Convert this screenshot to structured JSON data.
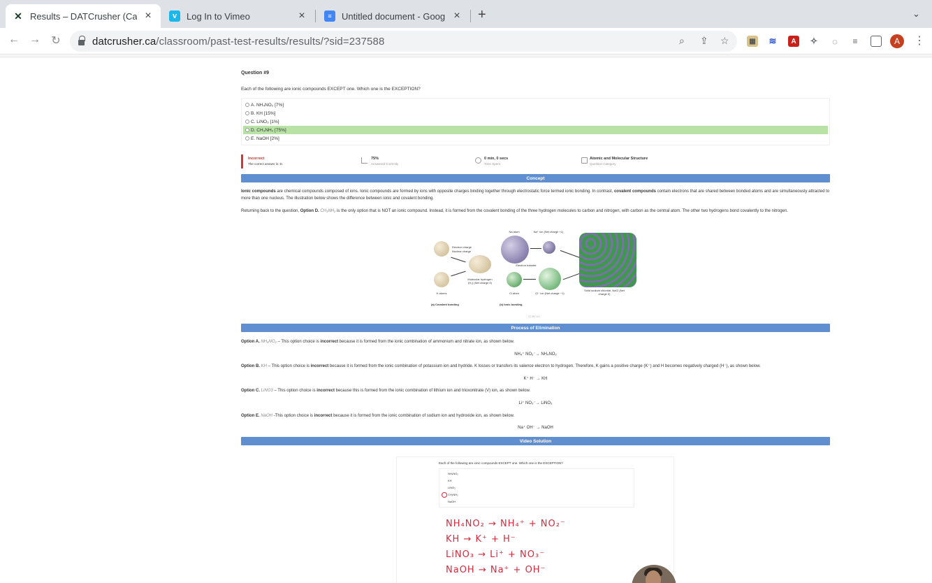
{
  "browser": {
    "tabs": [
      {
        "title": "Results – DATCrusher (Canada",
        "active": true
      },
      {
        "title": "Log In to Vimeo",
        "active": false
      },
      {
        "title": "Untitled document - Google Do",
        "active": false
      }
    ],
    "url_domain": "datcrusher.ca",
    "url_path": "/classroom/past-test-results/results/?sid=237588",
    "avatar_letter": "A"
  },
  "question": {
    "number_label": "Question #9",
    "text": "Each of the following are ionic compounds EXCEPT one. Which one is the EXCEPTION?",
    "options": [
      {
        "label": "A. NH₄NO₂ [7%]",
        "correct": false
      },
      {
        "label": "B. KH [15%]",
        "correct": false
      },
      {
        "label": "C. LiNO₃ [1%]",
        "correct": false
      },
      {
        "label": "D. CH₃NH₂ [75%]",
        "correct": true
      },
      {
        "label": "E. NaOH [2%]",
        "correct": false
      }
    ]
  },
  "stats": {
    "result": "Incorrect",
    "correct_answer": "The correct answer is: D.",
    "percent": "75%",
    "percent_label": "Answered Correctly",
    "time": "0 min, 0 secs",
    "time_label": "Time Spent",
    "category": "Atomic and Molecular Structure",
    "category_label": "Question Category"
  },
  "sections": {
    "concept": "Concept",
    "elimination": "Process of Elimination",
    "video": "Video Solution"
  },
  "concept": {
    "p1_b1": "Ionic compounds",
    "p1_t1": " are chemical compounds composed of ions. Ionic compounds are formed by ions with opposite charges binding together through electrostatic force termed ionic bonding. In contrast, ",
    "p1_b2": "covalent compounds",
    "p1_t2": " contain electrons that are shared between bonded atoms and are simultaneously attracted to more than one nucleus. The illustration below shows the difference between ionic and covalent bonding.",
    "p2_t1": "Returning back to the question, ",
    "p2_b1": "Option D.",
    "p2_i1": " CH₃NH₂",
    "p2_t2": " is the only option that is NOT an ionic compound. Instead, it is formed from the covalent bonding of the three hydrogen molecules to carbon and nitrogen, with carbon as the central atom. The other two hydrogens bond covalently to the nitrogen."
  },
  "illustration": {
    "na_atom": "Na atom",
    "na_ion": "Na⁺ ion (Net charge +1)",
    "electron_transfer": "Electron transfer",
    "electron_charge": "Electron charge",
    "nuclear_charge": "Nuclear charge",
    "molecular_h": "Molecular hydrogen (H₂) (Net charge 0)",
    "h_atoms": "H atoms",
    "cl_atom": "Cl atom",
    "cl_ion": "Cl⁻ ion (Net charge −1)",
    "nacl": "Solid sodium chloride, NaCl (Net charge 0)",
    "cap_a": "(a) Covalent bonding",
    "cap_b": "(b) Ionic bonding",
    "credit": "CC BY 4.0"
  },
  "elimination": {
    "a_label": "Option A.",
    "a_formula": " NH₄NO₂",
    "a_t1": " – This option choice is ",
    "a_b": "incorrect",
    "a_t2": " because it is formed from the ionic combination of ammonium and nitrate ion, as shown below.",
    "a_eq": "NH₄⁺ NO₂⁻→ NH₄NO₂",
    "b_label": "Option B.",
    "b_formula": " KH",
    "b_t1": " – This option choice is ",
    "b_b": "incorrect",
    "b_t2": " because it is formed from the ionic combination of potassium ion and hydride. K losses or transfers its valence electron to hydrogen. Therefore, K gains a positive charge (K⁺) and H becomes negatively charged (H⁻), as shown below.",
    "b_eq": "K⁺ H⁻ → KH",
    "c_label": "Option C.",
    "c_formula": " LiNO3",
    "c_t1": " – This option choice is ",
    "c_b": "incorrect",
    "c_t2": " because this is formed from the ionic combination of lithium ion and trioxonitrate (V) ion, as shown below.",
    "c_eq": "Li⁺ NO₃⁻→ LiNO₃",
    "e_label": "Option E.",
    "e_formula": " NaOH",
    "e_t1": " -This option choice is ",
    "e_b": "incorrect",
    "e_t2": " because it is formed from the ionic combination of sodium ion and hydroxide ion, as shown below.",
    "e_eq": "Na⁺ OH⁻ → NaOH"
  },
  "video": {
    "question": "Each of the following are ionic compounds EXCEPT one. Which one is the EXCEPTION?",
    "options": [
      "NH₄NO₂",
      "KH",
      "LiNO₃",
      "CH₃NH₂",
      "NaOH"
    ],
    "lines": [
      "NH₄NO₂ → NH₄⁺ + NO₂⁻",
      "KH → K⁺ + H⁻",
      "LiNO₃ → Li⁺ + NO₃⁻",
      "NaOH → Na⁺ + OH⁻"
    ]
  }
}
